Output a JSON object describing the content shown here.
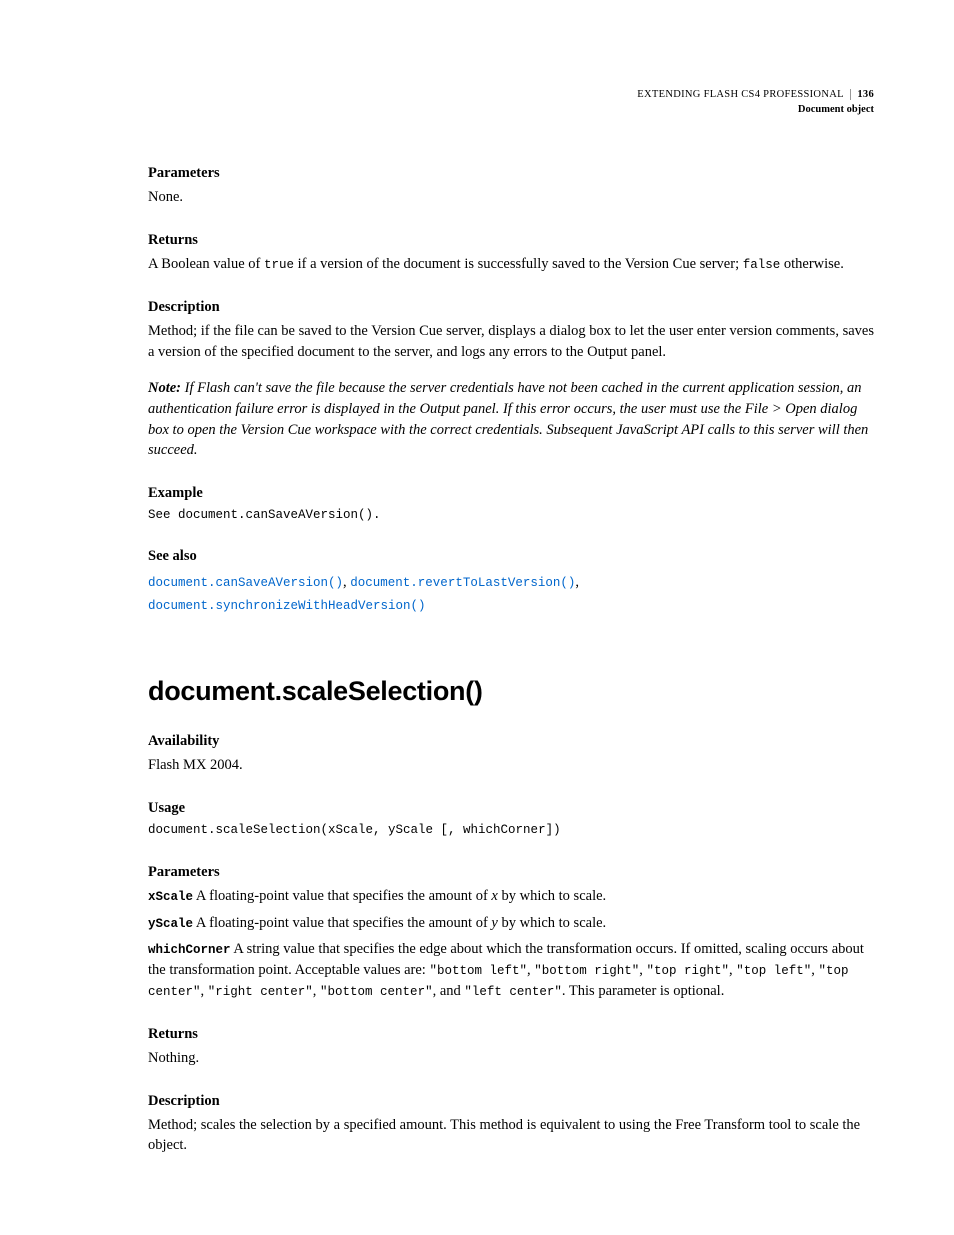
{
  "header": {
    "title": "EXTENDING FLASH CS4 PROFESSIONAL",
    "page_number": "136",
    "subtitle": "Document object"
  },
  "section1": {
    "parameters_heading": "Parameters",
    "parameters_body": "None.",
    "returns_heading": "Returns",
    "returns_prefix": "A Boolean value of ",
    "returns_true": "true",
    "returns_mid": " if a version of the document is successfully saved to the Version Cue server; ",
    "returns_false": "false",
    "returns_suffix": " otherwise.",
    "description_heading": "Description",
    "description_body": "Method; if the file can be saved to the Version Cue server, displays a dialog box to let the user enter version comments, saves a version of the specified document to the server, and logs any errors to the Output panel.",
    "note_label": "Note:",
    "note_body": " If Flash can't save the file because the server credentials have not been cached in the current application session, an authentication failure error is displayed in the Output panel. If this error occurs, the user must use the File > Open dialog box to open the Version Cue workspace with the correct credentials. Subsequent JavaScript API calls to this server will then succeed.",
    "example_heading": "Example",
    "example_code": "See document.canSaveAVersion().",
    "see_also_heading": "See also",
    "see_also_link1": "document.canSaveAVersion()",
    "see_also_sep1": ", ",
    "see_also_link2": "document.revertToLastVersion()",
    "see_also_sep2": ", ",
    "see_also_link3": "document.synchronizeWithHeadVersion()"
  },
  "section2": {
    "title": "document.scaleSelection()",
    "availability_heading": "Availability",
    "availability_body": "Flash MX 2004.",
    "usage_heading": "Usage",
    "usage_code": "document.scaleSelection(xScale, yScale [, whichCorner])",
    "parameters_heading": "Parameters",
    "param1_name": "xScale",
    "param1_prefix": "  A floating-point value that specifies the amount of ",
    "param1_var": "x",
    "param1_suffix": " by which to scale.",
    "param2_name": "yScale",
    "param2_prefix": "  A floating-point value that specifies the amount of ",
    "param2_var": "y",
    "param2_suffix": " by which to scale.",
    "param3_name": "whichCorner",
    "param3_prefix": "  A string value that specifies the edge about which the transformation occurs. If omitted, scaling occurs about the transformation point. Acceptable values are: ",
    "param3_v1": "\"bottom left\"",
    "param3_s1": ", ",
    "param3_v2": "\"bottom right\"",
    "param3_s2": ", ",
    "param3_v3": "\"top right\"",
    "param3_s3": ", ",
    "param3_v4": "\"top left\"",
    "param3_s4": ", ",
    "param3_v5": "\"top center\"",
    "param3_s5": ", ",
    "param3_v6": "\"right center\"",
    "param3_s6": ", ",
    "param3_v7": "\"bottom center\"",
    "param3_s7": ", and ",
    "param3_v8": "\"left center\"",
    "param3_suffix": ". This parameter is optional.",
    "returns_heading": "Returns",
    "returns_body": "Nothing.",
    "description_heading": "Description",
    "description_body": "Method; scales the selection by a specified amount. This method is equivalent to using the Free Transform tool to scale the object."
  }
}
